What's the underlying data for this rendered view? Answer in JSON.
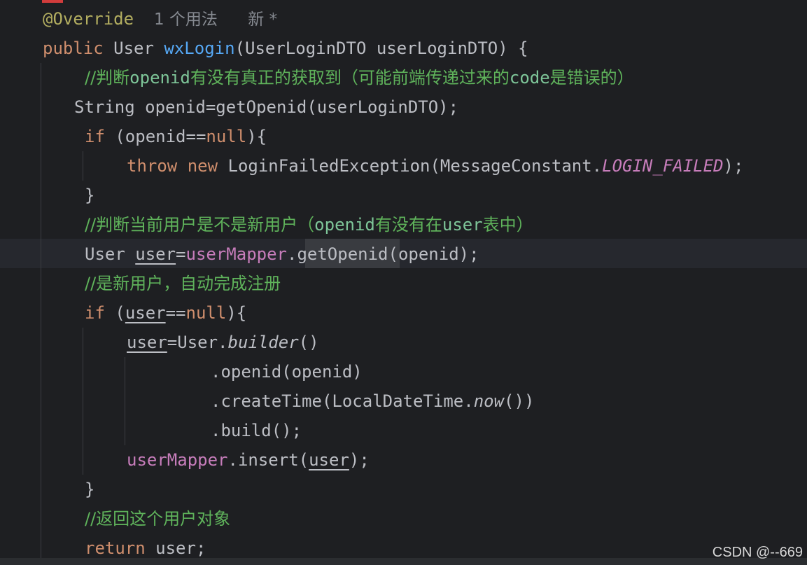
{
  "annotation": "@Override",
  "usage_hint": "1 个用法",
  "author_hint": "新 *",
  "code": {
    "l2": {
      "kw_public": "public",
      "type_user": " User ",
      "method": "wxLogin",
      "params": "(UserLoginDTO userLoginDTO) {"
    },
    "l3": {
      "slashes": "//判断",
      "w1": "openid",
      "z1": "有没有真正的获取到（可能前端传递过来的",
      "w2": "code",
      "z2": "是错误的）"
    },
    "l4": {
      "text": "String openid=getOpenid(userLoginDTO);"
    },
    "l5": {
      "kw": "if",
      "a": " (openid==",
      "null": "null",
      "b": "){"
    },
    "l6": {
      "kw_throw": "throw",
      "kw_new": " new",
      "a": " LoginFailedException(MessageConstant.",
      "const": "LOGIN_FAILED",
      "b": ");"
    },
    "l7": {
      "text": "}"
    },
    "l8": {
      "slashes": "//判断当前用户是不是新用户（",
      "w1": "openid",
      "z1": "有没有在",
      "w2": "user",
      "z2": "表中）"
    },
    "l9": {
      "a": "User ",
      "var": "user",
      "eq": "=",
      "field": "userMapper",
      "dot": ".",
      "call": "getOpenid",
      "b": "(openid);"
    },
    "l10": {
      "text": "//是新用户，自动完成注册"
    },
    "l11": {
      "kw": "if",
      "a": " (",
      "var": "user",
      "b": "==",
      "null": "null",
      "c": "){"
    },
    "l12": {
      "var": "user",
      "a": "=User.",
      "st": "builder",
      "b": "()"
    },
    "l13": {
      "text": ".openid(openid)"
    },
    "l14": {
      "a": ".createTime(LocalDateTime.",
      "st": "now",
      "b": "())"
    },
    "l15": {
      "text": ".build();"
    },
    "l16": {
      "field": "userMapper",
      "a": ".insert(",
      "var": "user",
      "b": ");"
    },
    "l17": {
      "text": "}"
    },
    "l18": {
      "text": "//返回这个用户对象"
    },
    "l19": {
      "kw": "return",
      "a": " user;"
    }
  },
  "watermark": "CSDN @--669"
}
